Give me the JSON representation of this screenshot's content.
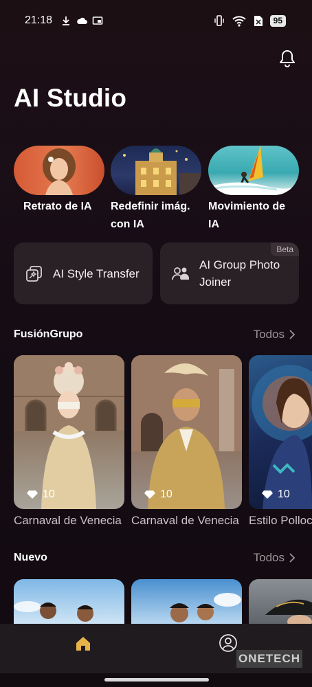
{
  "status_bar": {
    "time": "21:18",
    "battery": "95"
  },
  "header": {
    "title": "AI Studio"
  },
  "features": [
    {
      "label": "Retrato de IA"
    },
    {
      "label": "Redefinir imág. con IA"
    },
    {
      "label": "Movimiento de IA"
    }
  ],
  "tools": [
    {
      "label": "AI Style Transfer"
    },
    {
      "label": "AI Group Photo Joiner",
      "badge": "Beta"
    }
  ],
  "sections": {
    "fusion": {
      "title": "FusiónGrupo",
      "link": "Todos",
      "cards": [
        {
          "caption": "Carnaval de Venecia",
          "count": "10"
        },
        {
          "caption": "Carnaval de Venecia",
          "count": "10"
        },
        {
          "caption": "Estilo Polloc",
          "count": "10"
        }
      ]
    },
    "nuevo": {
      "title": "Nuevo",
      "link": "Todos"
    }
  },
  "watermark": "ONETECH",
  "colors": {
    "background": "#150c14",
    "card": "#2a2126",
    "nav": "#201b1f"
  }
}
